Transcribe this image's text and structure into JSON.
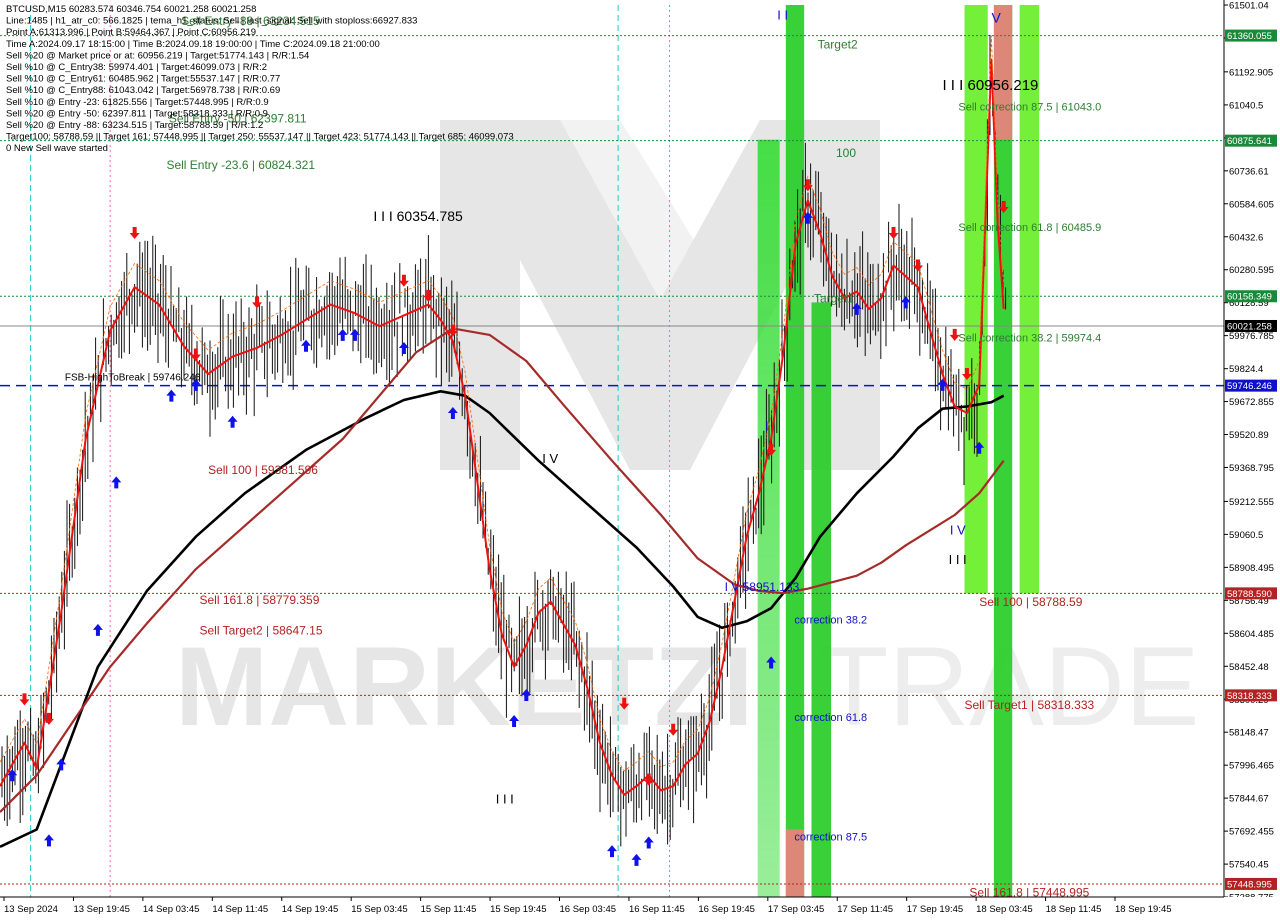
{
  "header": {
    "info_lines": [
      "BTCUSD,M15  60283.574 60346.754 60021.258 60021.258",
      "Line:1485  |  h1_atr_c0: 566.1825  |  tema_h1_status: Sell  |  last_signal: Sell  with stoploss:66927.833",
      "Point A:61313.996  |  Point B:59464.367  |  Point C:60956.219",
      "Time A:2024.09.17 18:15:00  |  Time B:2024.09.18 19:00:00  |  Time C:2024.09.18 21:00:00",
      "Sell %20 @ Market price or at: 60956.219  |  Target:51774.143  |  R/R:1.54",
      "Sell %10 @ C_Entry38: 59974.401  |  Target:46099.073  |  R/R:2",
      "Sell %10 @ C_Entry61: 60485.962  |  Target:55537.147  |  R/R:0.77",
      "Sell %10 @ C_Entry88: 61043.042  |  Target:56978.738  |  R/R:0.69",
      "Sell %10 @ Entry -23: 61825.556  |  Target:57448.995  |  R/R:0.9",
      "Sell %20 @ Entry -50: 62397.811  |  Target:58318.333  |  R/R:0.9",
      "Sell %20 @ Entry -88: 63234.515  |  Target:58788.59  |  R/R:1.2",
      "Target100: 58788.59  ||  Target 161: 57448.995  ||  Target 250: 55537.147  ||  Target 423: 51774.143  ||  Target 685: 46099.073",
      "0 New Sell wave started"
    ]
  },
  "chart_data": {
    "type": "candlestick",
    "symbol": "BTCUSD",
    "timeframe": "M15",
    "ohlc_last": {
      "open": 60283.574,
      "high": 60346.754,
      "low": 60021.258,
      "close": 60021.258
    },
    "ylim": [
      57388.775,
      61501.04
    ],
    "y_ticks": [
      61501.04,
      61348.775,
      61192.905,
      61040.5,
      60888.175,
      60736.61,
      60584.605,
      60432.6,
      60280.595,
      60128.59,
      59976.785,
      59824.4,
      59672.855,
      59520.89,
      59368.795,
      59212.555,
      59060.5,
      58908.495,
      58756.49,
      58604.485,
      58452.48,
      58300.29,
      58148.47,
      57996.465,
      57844.67,
      57692.455,
      57540.45,
      57388.775
    ],
    "x_ticks": [
      "13 Sep 2024",
      "13 Sep 19:45",
      "14 Sep 03:45",
      "14 Sep 11:45",
      "14 Sep 19:45",
      "15 Sep 03:45",
      "15 Sep 11:45",
      "15 Sep 19:45",
      "16 Sep 03:45",
      "16 Sep 11:45",
      "16 Sep 19:45",
      "17 Sep 03:45",
      "17 Sep 11:45",
      "17 Sep 19:45",
      "18 Sep 03:45",
      "18 Sep 11:45",
      "18 Sep 19:45"
    ],
    "price_tags": [
      {
        "value": 61360.055,
        "label": "61360.055",
        "color": "#1a8a3a"
      },
      {
        "value": 60875.641,
        "label": "60875.641",
        "color": "#1a8a3a"
      },
      {
        "value": 60158.349,
        "label": "60158.349",
        "color": "#1a8a3a"
      },
      {
        "value": 60021.258,
        "label": "60021.258",
        "color": "#000000"
      },
      {
        "value": 59746.246,
        "label": "59746.246",
        "color": "#1010cc"
      },
      {
        "value": 58788.59,
        "label": "58788.590",
        "color": "#b22222"
      },
      {
        "value": 58318.333,
        "label": "58318.333",
        "color": "#b22222"
      },
      {
        "value": 57448.995,
        "label": "57448.995",
        "color": "#b22222"
      }
    ],
    "level_lines": [
      {
        "value": 61360.055,
        "color": "#1a8a3a",
        "style": "dotted"
      },
      {
        "value": 60875.641,
        "color": "#1a8a3a",
        "style": "dotted"
      },
      {
        "value": 60158.349,
        "color": "#1a8a3a",
        "style": "dotted"
      },
      {
        "value": 60021.258,
        "color": "#888888",
        "style": "solid"
      },
      {
        "value": 59746.246,
        "color": "#1010cc",
        "style": "dashed"
      },
      {
        "value": 58788.59,
        "color": "#b22222",
        "style": "dotted"
      },
      {
        "value": 58318.333,
        "color": "#b22222",
        "style": "dotted"
      },
      {
        "value": 57448.995,
        "color": "#b22222",
        "style": "dotted"
      }
    ],
    "annotations": [
      {
        "text": "Sell Entry -88 | 63234.515",
        "x": 0.148,
        "y": 61408,
        "color": "#2e7d32",
        "size": 12
      },
      {
        "text": "Sell Entry -50 | 62397.811",
        "x": 0.138,
        "y": 60960,
        "color": "#2e7d32",
        "size": 12
      },
      {
        "text": "Sell Entry -23.6 | 60824.321",
        "x": 0.136,
        "y": 60745,
        "color": "#2e7d32",
        "size": 12
      },
      {
        "text": "I I I 60354.785",
        "x": 0.305,
        "y": 60505,
        "color": "#000000",
        "size": 14
      },
      {
        "text": "I I I 60956.219",
        "x": 0.77,
        "y": 61110,
        "color": "#000000",
        "size": 15
      },
      {
        "text": "FSB-HighToBreak | 59746.246",
        "x": 0.053,
        "y": 59770,
        "color": "#000000",
        "size": 10
      },
      {
        "text": "Sell 100 | 59381.596",
        "x": 0.17,
        "y": 59340,
        "color": "#b22222",
        "size": 12
      },
      {
        "text": "Sell 161.8 | 58779.359",
        "x": 0.163,
        "y": 58740,
        "color": "#b22222",
        "size": 12
      },
      {
        "text": "Sell Target2 | 58647.15",
        "x": 0.163,
        "y": 58600,
        "color": "#b22222",
        "size": 12
      },
      {
        "text": "I V",
        "x": 0.443,
        "y": 59390,
        "color": "#000000",
        "size": 13
      },
      {
        "text": "I I I",
        "x": 0.405,
        "y": 57820,
        "color": "#000000",
        "size": 13
      },
      {
        "text": "I V 58951.133",
        "x": 0.592,
        "y": 58800,
        "color": "#1010cc",
        "size": 12
      },
      {
        "text": "I",
        "x": 0.625,
        "y": 59540,
        "color": "#1010cc",
        "size": 13
      },
      {
        "text": "I I",
        "x": 0.635,
        "y": 61435,
        "color": "#1010cc",
        "size": 13
      },
      {
        "text": "Target2",
        "x": 0.668,
        "y": 61300,
        "color": "#2e7d32",
        "size": 12
      },
      {
        "text": "100",
        "x": 0.683,
        "y": 60800,
        "color": "#2e7d32",
        "size": 12
      },
      {
        "text": "Target1",
        "x": 0.665,
        "y": 60130,
        "color": "#2e7d32",
        "size": 12
      },
      {
        "text": "correction 38.2",
        "x": 0.649,
        "y": 58650,
        "color": "#1010cc",
        "size": 11
      },
      {
        "text": "correction 61.8",
        "x": 0.649,
        "y": 58200,
        "color": "#1010cc",
        "size": 11
      },
      {
        "text": "correction 87.5",
        "x": 0.649,
        "y": 57650,
        "color": "#1010cc",
        "size": 11
      },
      {
        "text": "Sell correction 87.5 | 61043.0",
        "x": 0.783,
        "y": 61015,
        "color": "#2e7d32",
        "size": 11
      },
      {
        "text": "Sell correction 61.8 | 60485.9",
        "x": 0.783,
        "y": 60460,
        "color": "#2e7d32",
        "size": 11
      },
      {
        "text": "Sell correction 38.2 | 59974.4",
        "x": 0.783,
        "y": 59950,
        "color": "#2e7d32",
        "size": 11
      },
      {
        "text": "I V",
        "x": 0.776,
        "y": 59060,
        "color": "#1010cc",
        "size": 13
      },
      {
        "text": "I I I",
        "x": 0.775,
        "y": 58925,
        "color": "#000000",
        "size": 13
      },
      {
        "text": "V",
        "x": 0.81,
        "y": 61420,
        "color": "#1010cc",
        "size": 14
      },
      {
        "text": "Sell 100 | 58788.59",
        "x": 0.8,
        "y": 58730,
        "color": "#b22222",
        "size": 12
      },
      {
        "text": "Sell Target1 | 58318.333",
        "x": 0.788,
        "y": 58255,
        "color": "#b22222",
        "size": 12
      },
      {
        "text": "Sell 161.8 | 57448.995",
        "x": 0.792,
        "y": 57390,
        "color": "#b22222",
        "size": 12
      }
    ],
    "series": [
      {
        "name": "",
        "color": "#000000",
        "width": 2.6,
        "points": [
          [
            0,
            57620
          ],
          [
            0.03,
            57700
          ],
          [
            0.05,
            58000
          ],
          [
            0.08,
            58450
          ],
          [
            0.12,
            58800
          ],
          [
            0.16,
            59050
          ],
          [
            0.2,
            59250
          ],
          [
            0.25,
            59450
          ],
          [
            0.3,
            59600
          ],
          [
            0.33,
            59680
          ],
          [
            0.36,
            59720
          ],
          [
            0.38,
            59700
          ],
          [
            0.4,
            59620
          ],
          [
            0.44,
            59400
          ],
          [
            0.48,
            59200
          ],
          [
            0.52,
            59000
          ],
          [
            0.55,
            58820
          ],
          [
            0.57,
            58680
          ],
          [
            0.59,
            58630
          ],
          [
            0.61,
            58660
          ],
          [
            0.63,
            58720
          ],
          [
            0.65,
            58860
          ],
          [
            0.67,
            59050
          ],
          [
            0.7,
            59250
          ],
          [
            0.73,
            59420
          ],
          [
            0.75,
            59550
          ],
          [
            0.77,
            59640
          ],
          [
            0.79,
            59650
          ],
          [
            0.81,
            59670
          ],
          [
            0.82,
            59700
          ]
        ]
      },
      {
        "name": "",
        "color": "#a52a2a",
        "width": 2.2,
        "points": [
          [
            0,
            57780
          ],
          [
            0.03,
            57950
          ],
          [
            0.06,
            58200
          ],
          [
            0.09,
            58450
          ],
          [
            0.12,
            58650
          ],
          [
            0.16,
            58900
          ],
          [
            0.2,
            59100
          ],
          [
            0.24,
            59300
          ],
          [
            0.28,
            59500
          ],
          [
            0.31,
            59700
          ],
          [
            0.34,
            59900
          ],
          [
            0.37,
            60010
          ],
          [
            0.4,
            59980
          ],
          [
            0.43,
            59860
          ],
          [
            0.46,
            59660
          ],
          [
            0.5,
            59400
          ],
          [
            0.54,
            59150
          ],
          [
            0.57,
            58950
          ],
          [
            0.6,
            58830
          ],
          [
            0.62,
            58800
          ],
          [
            0.64,
            58790
          ],
          [
            0.66,
            58810
          ],
          [
            0.68,
            58840
          ],
          [
            0.7,
            58870
          ],
          [
            0.72,
            58930
          ],
          [
            0.74,
            59010
          ],
          [
            0.76,
            59080
          ],
          [
            0.78,
            59150
          ],
          [
            0.8,
            59250
          ],
          [
            0.82,
            59400
          ]
        ]
      },
      {
        "name": "",
        "color": "#ee1111",
        "width": 2.0,
        "points": [
          [
            0,
            57900
          ],
          [
            0.02,
            58100
          ],
          [
            0.03,
            57980
          ],
          [
            0.05,
            58700
          ],
          [
            0.07,
            59500
          ],
          [
            0.09,
            60000
          ],
          [
            0.11,
            60200
          ],
          [
            0.13,
            60120
          ],
          [
            0.15,
            59930
          ],
          [
            0.17,
            59800
          ],
          [
            0.19,
            59880
          ],
          [
            0.21,
            59920
          ],
          [
            0.23,
            59980
          ],
          [
            0.25,
            60050
          ],
          [
            0.27,
            60120
          ],
          [
            0.29,
            60080
          ],
          [
            0.31,
            60020
          ],
          [
            0.33,
            60070
          ],
          [
            0.35,
            60120
          ],
          [
            0.36,
            60050
          ],
          [
            0.37,
            59950
          ],
          [
            0.38,
            59700
          ],
          [
            0.39,
            59300
          ],
          [
            0.4,
            58900
          ],
          [
            0.41,
            58600
          ],
          [
            0.42,
            58450
          ],
          [
            0.43,
            58550
          ],
          [
            0.44,
            58700
          ],
          [
            0.45,
            58750
          ],
          [
            0.46,
            58650
          ],
          [
            0.47,
            58550
          ],
          [
            0.48,
            58350
          ],
          [
            0.49,
            58100
          ],
          [
            0.5,
            57950
          ],
          [
            0.51,
            57860
          ],
          [
            0.52,
            57900
          ],
          [
            0.53,
            57950
          ],
          [
            0.54,
            57880
          ],
          [
            0.55,
            57900
          ],
          [
            0.56,
            58000
          ],
          [
            0.57,
            58050
          ],
          [
            0.58,
            58200
          ],
          [
            0.59,
            58450
          ],
          [
            0.6,
            58750
          ],
          [
            0.61,
            59050
          ],
          [
            0.62,
            59250
          ],
          [
            0.63,
            59500
          ],
          [
            0.64,
            59900
          ],
          [
            0.65,
            60400
          ],
          [
            0.66,
            60600
          ],
          [
            0.67,
            60450
          ],
          [
            0.68,
            60250
          ],
          [
            0.69,
            60150
          ],
          [
            0.7,
            60180
          ],
          [
            0.71,
            60100
          ],
          [
            0.72,
            60150
          ],
          [
            0.73,
            60300
          ],
          [
            0.74,
            60250
          ],
          [
            0.75,
            60200
          ],
          [
            0.76,
            60000
          ],
          [
            0.77,
            59800
          ],
          [
            0.78,
            59650
          ],
          [
            0.79,
            59620
          ],
          [
            0.8,
            59750
          ],
          [
            0.805,
            60500
          ],
          [
            0.81,
            61250
          ],
          [
            0.815,
            60500
          ],
          [
            0.82,
            60100
          ]
        ]
      }
    ],
    "candles_seed": 7,
    "signals_buy": [
      [
        0.01,
        57950
      ],
      [
        0.04,
        57650
      ],
      [
        0.05,
        58000
      ],
      [
        0.08,
        58620
      ],
      [
        0.095,
        59300
      ],
      [
        0.14,
        59700
      ],
      [
        0.16,
        59750
      ],
      [
        0.19,
        59580
      ],
      [
        0.25,
        59930
      ],
      [
        0.28,
        59980
      ],
      [
        0.29,
        59980
      ],
      [
        0.33,
        59920
      ],
      [
        0.37,
        59620
      ],
      [
        0.42,
        58200
      ],
      [
        0.43,
        58320
      ],
      [
        0.5,
        57600
      ],
      [
        0.52,
        57560
      ],
      [
        0.53,
        57640
      ],
      [
        0.63,
        58470
      ],
      [
        0.66,
        60520
      ],
      [
        0.7,
        60100
      ],
      [
        0.74,
        60130
      ],
      [
        0.77,
        59750
      ],
      [
        0.8,
        59460
      ]
    ],
    "signals_sell": [
      [
        0.02,
        58300
      ],
      [
        0.04,
        58210
      ],
      [
        0.11,
        60450
      ],
      [
        0.16,
        59890
      ],
      [
        0.21,
        60130
      ],
      [
        0.33,
        60230
      ],
      [
        0.35,
        60160
      ],
      [
        0.37,
        60000
      ],
      [
        0.51,
        58280
      ],
      [
        0.53,
        57930
      ],
      [
        0.55,
        58160
      ],
      [
        0.63,
        59450
      ],
      [
        0.66,
        60670
      ],
      [
        0.73,
        60450
      ],
      [
        0.75,
        60300
      ],
      [
        0.78,
        59980
      ],
      [
        0.79,
        59800
      ],
      [
        0.82,
        60570
      ]
    ],
    "vertical_lines": [
      {
        "x": 0.025,
        "color": "#22cccc",
        "style": "dashed"
      },
      {
        "x": 0.09,
        "color": "#ff66aa",
        "style": "dotted"
      },
      {
        "x": 0.505,
        "color": "#22cccc",
        "style": "dashed"
      },
      {
        "x": 0.547,
        "color": "#ff66aa",
        "style": "dotted"
      }
    ],
    "bands": [
      {
        "x0": 0.619,
        "x1": 0.637,
        "y0": 57388,
        "y1": 60880,
        "color": "#33dd33",
        "fade": true
      },
      {
        "x0": 0.642,
        "x1": 0.657,
        "y0": 57388,
        "y1": 61501,
        "color": "#22cc22",
        "fade": false
      },
      {
        "x0": 0.642,
        "x1": 0.657,
        "y0": 57388,
        "y1": 57700,
        "color": "#f08080",
        "fade": false
      },
      {
        "x0": 0.663,
        "x1": 0.679,
        "y0": 57388,
        "y1": 60130,
        "color": "#22cc22",
        "fade": false
      },
      {
        "x0": 0.788,
        "x1": 0.807,
        "y0": 58788,
        "y1": 61501,
        "color": "#66ee22",
        "fade": false
      },
      {
        "x0": 0.812,
        "x1": 0.827,
        "y0": 57388,
        "y1": 61501,
        "color": "#22cc22",
        "fade": false
      },
      {
        "x0": 0.812,
        "x1": 0.827,
        "y0": 60880,
        "y1": 61501,
        "color": "#f08080",
        "fade": false
      },
      {
        "x0": 0.833,
        "x1": 0.849,
        "y0": 58788,
        "y1": 61501,
        "color": "#66ee22",
        "fade": false
      }
    ]
  }
}
